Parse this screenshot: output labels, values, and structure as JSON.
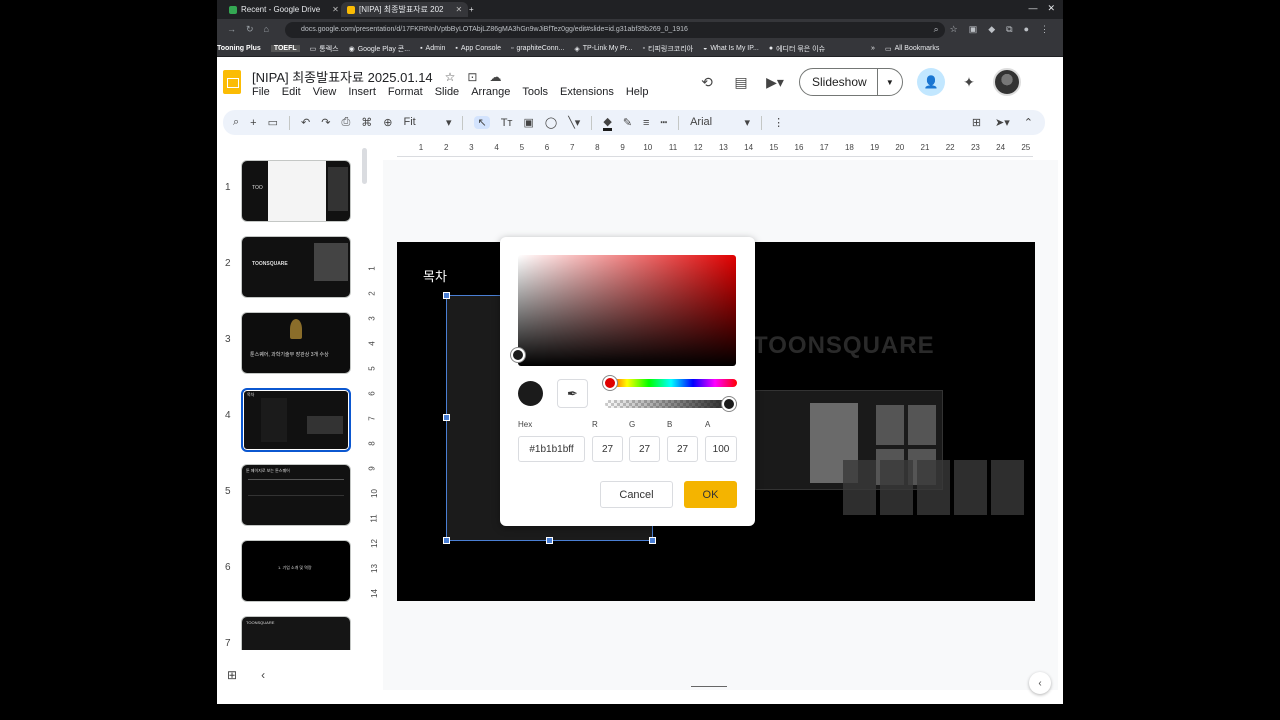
{
  "browser": {
    "tabs": [
      {
        "label": "Recent - Google Drive",
        "color": "#34a853"
      },
      {
        "label": "[NIPA] 최종발표자료 202",
        "color": "#fbbc04"
      }
    ],
    "new_tab": "+",
    "url": "docs.google.com/presentation/d/17FKRtNnlVptbByLOTAbjLZ86gMA3hGn9wJiBfTez0gg/edit#slide=id.g31abf35b269_0_1916",
    "bookmarks": [
      "Tooning Plus",
      "TOEFL",
      "통렉스",
      "Google Play 콘...",
      "Admin",
      "App Console",
      "graphiteConn...",
      "TP-Link My Pr...",
      "티피링크코리아",
      "What Is My IP...",
      "에디터 묶은 이슈",
      "»",
      "All Bookmarks"
    ]
  },
  "app": {
    "title": "[NIPA] 최종발표자료 2025.01.14",
    "menu": [
      "File",
      "Edit",
      "View",
      "Insert",
      "Format",
      "Slide",
      "Arrange",
      "Tools",
      "Extensions",
      "Help"
    ],
    "slideshow_label": "Slideshow"
  },
  "toolbar": {
    "zoom": "Fit",
    "font": "Arial"
  },
  "ruler": {
    "h": [
      "1",
      "2",
      "3",
      "4",
      "5",
      "6",
      "7",
      "8",
      "9",
      "10",
      "11",
      "12",
      "13",
      "14",
      "15",
      "16",
      "17",
      "18",
      "19",
      "20",
      "21",
      "22",
      "23",
      "24",
      "25"
    ],
    "v": [
      "1",
      "2",
      "3",
      "4",
      "5",
      "6",
      "7",
      "8",
      "9",
      "10",
      "11",
      "12",
      "13",
      "14"
    ]
  },
  "filmstrip": [
    {
      "num": "1",
      "caption": "TOO"
    },
    {
      "num": "2",
      "caption": "TOONSQUARE"
    },
    {
      "num": "3",
      "caption": "툰스퀘어, 과학기술부 장관상 3개 수상"
    },
    {
      "num": "4",
      "caption": "목차"
    },
    {
      "num": "5",
      "caption": "툰 페이지로 보는 툰스퀘어"
    },
    {
      "num": "6",
      "caption": "1. 기업 소개 및 역량"
    },
    {
      "num": "7",
      "caption": "TOONSQUARE"
    }
  ],
  "slide": {
    "title": "목차",
    "brand": "TOONSQUARE"
  },
  "color_picker": {
    "hex_label": "Hex",
    "r_label": "R",
    "g_label": "G",
    "b_label": "B",
    "a_label": "A",
    "hex_value": "#1b1b1bff",
    "r_value": "27",
    "g_value": "27",
    "b_value": "27",
    "a_value": "100",
    "cancel": "Cancel",
    "ok": "OK",
    "current_color": "#1b1b1b",
    "accent": "#f4b400"
  }
}
